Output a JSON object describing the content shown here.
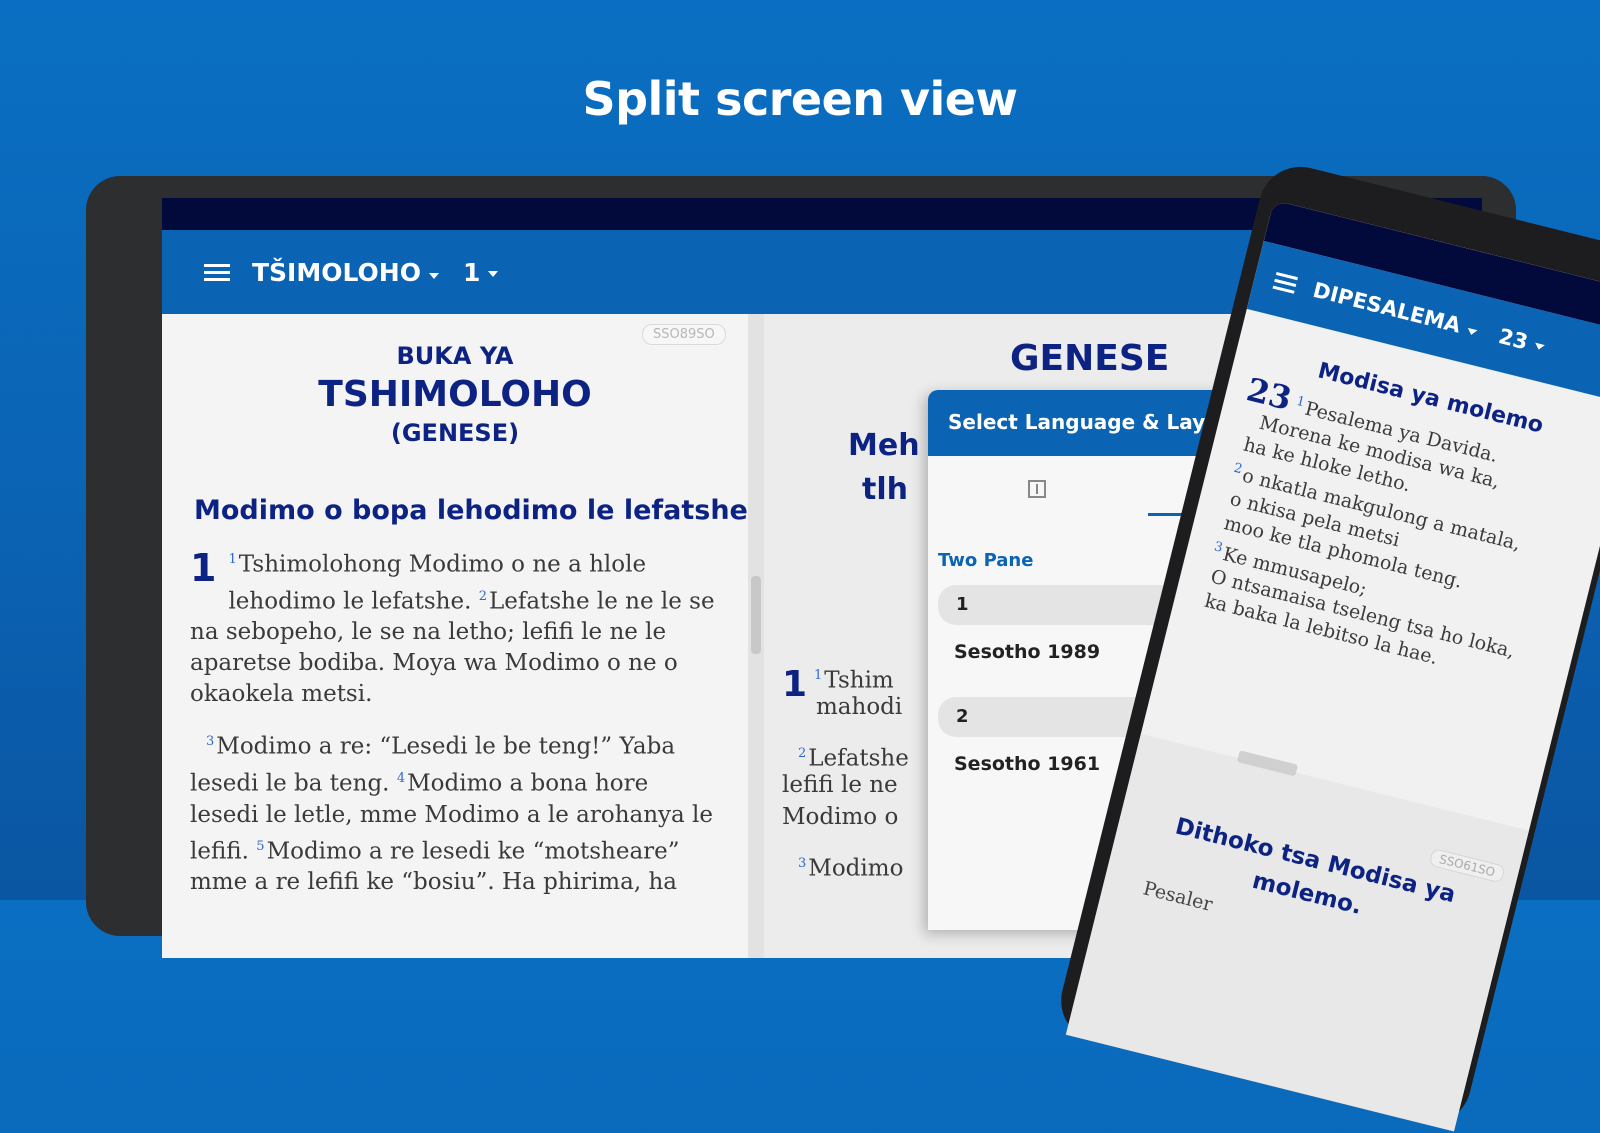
{
  "headline": "Split screen view",
  "tablet": {
    "book_menu": "TŠIMOLOHO",
    "chapter_menu": "1",
    "left_pane": {
      "version_badge": "SSO89SO",
      "book_line1": "BUKA YA",
      "book_line2": "TSHIMOLOHO",
      "book_line3": "(GENESE)",
      "section_heading": "Modimo o bopa lehodimo le lefatshe",
      "chapter_number": "1",
      "p1_v1_num": "1",
      "p1_v1": "Tshimolohong Modimo o ne a hlole lehodimo le lefatshe. ",
      "p1_v2_num": "2",
      "p1_v2": "Lefatshe le ne le se na sebopeho, le se na letho; lefifi le ne le aparetse bodiba. Moya wa Modimo o ne o okaokela metsi.",
      "p2_v3_num": "3",
      "p2_v3": "Modimo a re: “Lesedi le be teng!” Yaba lesedi le ba teng. ",
      "p2_v4_num": "4",
      "p2_v4": "Modimo a bona hore lesedi le letle, mme Modimo a le arohanya le lefifi. ",
      "p2_v5_num": "5",
      "p2_v5": "Modimo a re lesedi ke “motsheare” mme a re lefifi ke “bosiu”. Ha phirima, ha"
    },
    "right_pane": {
      "book_title": "GENESE",
      "heading_fragment_1": "Meh",
      "heading_fragment_2": "tlh",
      "chapter_number": "1",
      "v1_num": "1",
      "v1": "Tshim",
      "v1_cont": "mahodi",
      "v2_num": "2",
      "v2": "Lefatshe",
      "v2_cont1": "lefifi le ne",
      "v2_cont2": "Modimo o",
      "v3_num": "3",
      "v3": "Modimo"
    },
    "dialog": {
      "title": "Select Language & Layout",
      "layout_label": "Two Pane",
      "slot1_label": "1",
      "slot1_language": "Sesotho 1989",
      "slot2_label": "2",
      "slot2_language": "Sesotho 1961"
    }
  },
  "phone": {
    "book_menu": "DIPESALEMA",
    "chapter_menu": "23",
    "heading": "Modisa ya molemo",
    "chapter_number": "23",
    "v1_num": "1",
    "v1": "Pesalema ya Davida.",
    "lines": [
      "Morena ke modisa wa ka,",
      "ha ke hloke letho."
    ],
    "v2_num": "2",
    "v2_lines": [
      "o nkatla makgulong a matala,",
      "o nkisa pela metsi",
      "moo ke tla phomola teng."
    ],
    "v3_num": "3",
    "v3_lines": [
      "Ke mmusapelo;",
      "O ntsamaisa tseleng tsa ho loka,",
      "ka baka la lebitso la hae."
    ],
    "lower": {
      "version_badge": "SSO61SO",
      "heading": "Dithoko tsa Modisa ya molemo.",
      "text": "Pesaler"
    }
  },
  "colors": {
    "background": "#0a6fc2",
    "app_bar": "#0b63b4",
    "status_bar": "#020a3c",
    "heading_text": "#0d2383",
    "verse_number": "#2c6ad1"
  }
}
